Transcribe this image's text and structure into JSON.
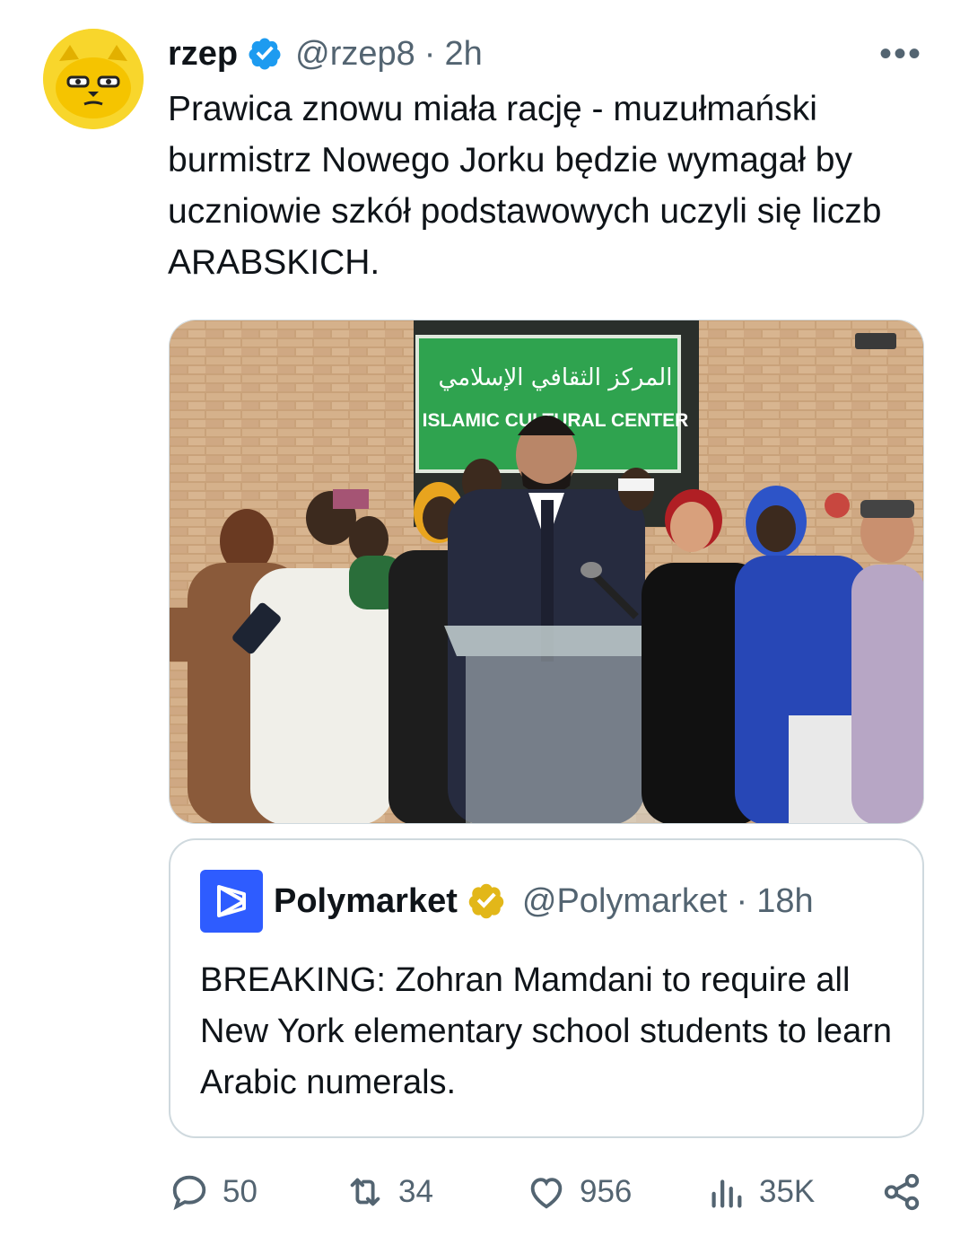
{
  "tweet": {
    "author_name": "rzep",
    "handle": "@rzep8",
    "separator": "·",
    "time": "2h",
    "more_label": "•••",
    "text": "Prawica znowu miała rację - muzułmański burmistrz Nowego Jorku będzie wymagał by uczniowie szkół podstawowych uczyli się liczb ARABSKICH.",
    "media_sign_arabic": "المركز الثقافي الإسلامي",
    "media_sign_latin": "ISLAMIC CULTURAL CENTER"
  },
  "quote": {
    "author_name": "Polymarket",
    "handle": "@Polymarket",
    "separator": "·",
    "time": "18h",
    "text": "BREAKING: Zohran Mamdani to require all New York elementary school students to learn Arabic numerals."
  },
  "actions": {
    "replies": "50",
    "reposts": "34",
    "likes": "956",
    "views": "35K"
  },
  "icons": [
    "verified-badge-icon",
    "more-icon",
    "gold-verified-badge-icon",
    "polymarket-logo-icon",
    "reply-icon",
    "repost-icon",
    "like-icon",
    "views-icon",
    "share-icon"
  ],
  "colors": {
    "verified_blue": "#1d9bf0",
    "gold_badge": "#e2b719",
    "polymarket_blue": "#2e5cff",
    "muted": "#536471"
  }
}
